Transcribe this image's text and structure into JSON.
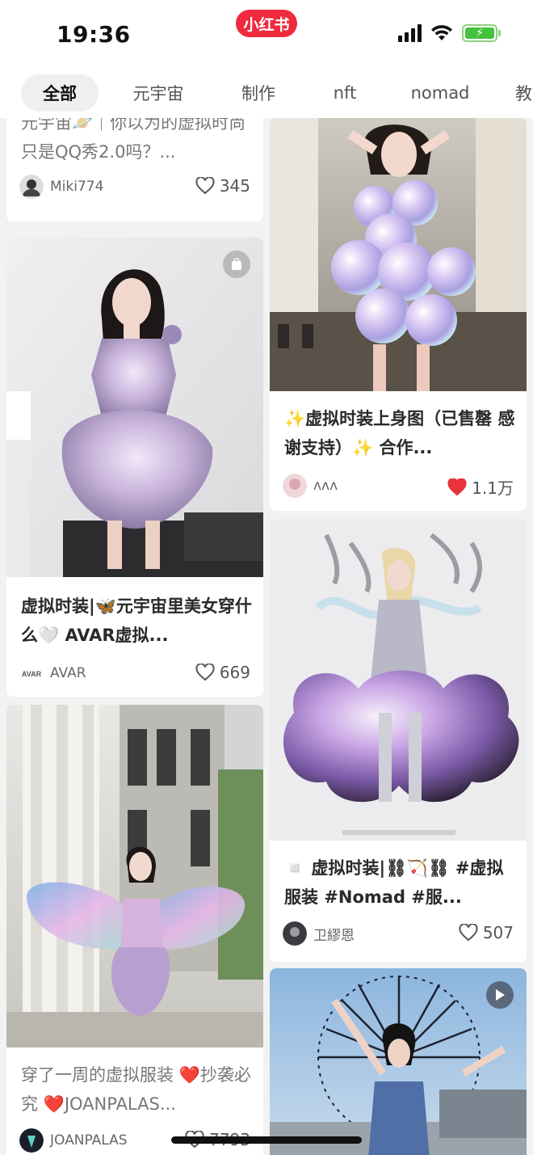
{
  "status_bar": {
    "time": "19:36",
    "app_badge": "小红书"
  },
  "tabs": [
    {
      "label": "全部",
      "active": true
    },
    {
      "label": "元宇宙"
    },
    {
      "label": "制作"
    },
    {
      "label": "nft"
    },
    {
      "label": "nomad"
    },
    {
      "label": "教"
    }
  ],
  "posts": [
    {
      "title": "元宇宙🪐｜你以为的虚拟时尚只是QQ秀2.0吗？...",
      "author": "Miki774",
      "likes": "345",
      "liked": false
    },
    {
      "title": "虚拟时装|🦋元宇宙里美女穿什么🤍 AVAR虚拟...",
      "author": "AVAR",
      "likes": "669",
      "liked": false
    },
    {
      "title": "穿了一周的虚拟服装 ❤️抄袭必究 ❤️JOANPALAS...",
      "author": "JOANPALAS",
      "likes": "7793",
      "liked": false
    },
    {
      "title": "✨虚拟时装上身图（已售罄 感谢支持）✨ 合作...",
      "author": "ʌʌʌ",
      "likes": "1.1万",
      "liked": true
    },
    {
      "title": "◽️ 虚拟时装|⛓🏹⛓ #虚拟服装 #Nomad #服...",
      "author": "卫繆恩",
      "likes": "507",
      "liked": false
    },
    {
      "title": "",
      "author": "",
      "likes": ""
    }
  ],
  "colors": {
    "brand": "#ee2a3c",
    "liked": "#e8323c",
    "battery": "#43c33b"
  },
  "icons": {
    "like": "heart-icon",
    "video": "play-icon",
    "shop": "bag-icon"
  }
}
